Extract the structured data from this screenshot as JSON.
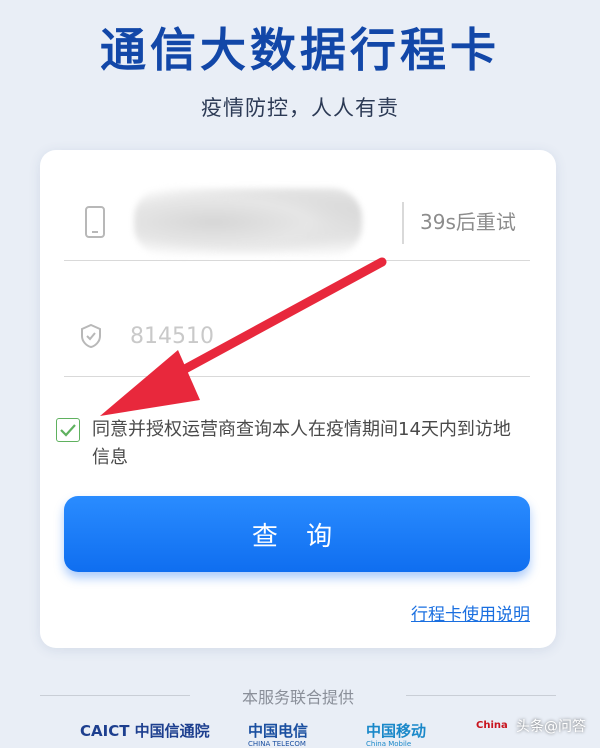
{
  "header": {
    "title": "通信大数据行程卡",
    "subtitle": "疫情防控，人人有责"
  },
  "form": {
    "retry_label": "39s后重试",
    "code_value": "814510",
    "consent_checked": true,
    "consent_text": "同意并授权运营商查询本人在疫情期间14天内到访地信息",
    "query_label": "查 询",
    "guide_link": "行程卡使用说明"
  },
  "footer": {
    "provider_text": "本服务联合提供",
    "logos": [
      {
        "name": "CAICT 中国信通院",
        "color": "#1d3f8f"
      },
      {
        "name": "中国电信",
        "sub": "CHINA TELECOM",
        "color": "#1a4fa0"
      },
      {
        "name": "中国移动",
        "sub": "China Mobile",
        "color": "#1a88c9"
      },
      {
        "name": "China",
        "color": "#c8141e"
      }
    ],
    "watermark": "头条@问答"
  },
  "colors": {
    "brand": "#1247a8",
    "primary": "#0f6ef0",
    "check": "#5fb15f",
    "arrow": "#e8283c"
  }
}
